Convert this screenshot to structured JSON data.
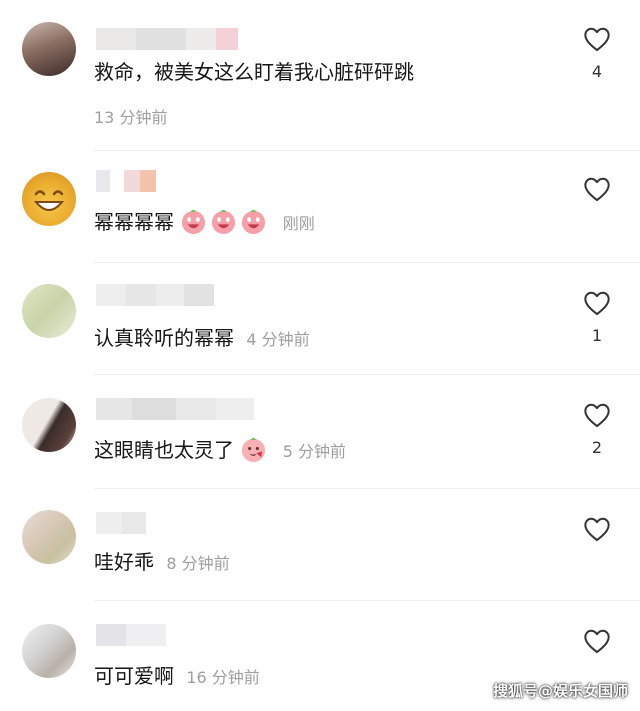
{
  "comments": [
    {
      "text": "救命，被美女这么盯着我心脏砰砰跳",
      "time": "13 分钟前",
      "likes": "4"
    },
    {
      "text": "幂幂幂幂",
      "time": "刚刚",
      "likes": ""
    },
    {
      "text": "认真聆听的幂幂",
      "time": "4 分钟前",
      "likes": "1"
    },
    {
      "text": "这眼睛也太灵了",
      "time": "5 分钟前",
      "likes": "2"
    },
    {
      "text": "哇好乖",
      "time": "8 分钟前",
      "likes": ""
    },
    {
      "text": "可可爱啊",
      "time": "16 分钟前",
      "likes": ""
    }
  ],
  "icons": {
    "like": "heart-outline-icon",
    "emoji": "pink-peach-face-icon"
  },
  "watermark": "搜狐号@娱乐女国师",
  "colors": {
    "text": "#161616",
    "time": "#9e9e9e",
    "divider": "#efefef"
  }
}
